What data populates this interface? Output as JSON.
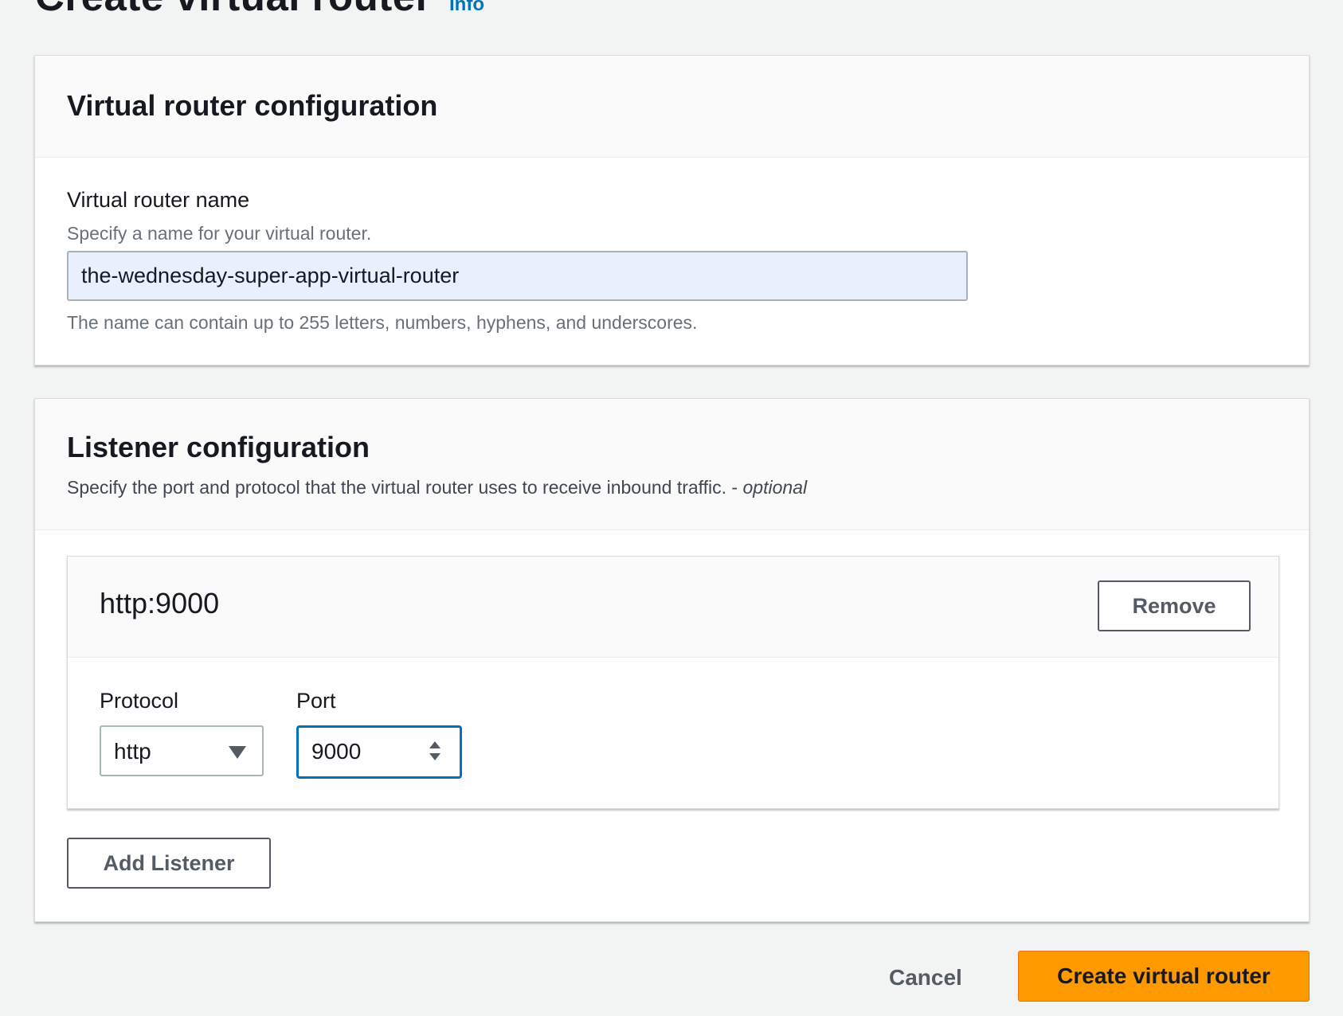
{
  "header": {
    "title": "Create virtual router",
    "info_link": "Info"
  },
  "virtual_router_config": {
    "title": "Virtual router configuration",
    "name_label": "Virtual router name",
    "name_description": "Specify a name for your virtual router.",
    "name_value": "the-wednesday-super-app-virtual-router",
    "name_constraint": "The name can contain up to 255 letters, numbers, hyphens, and underscores."
  },
  "listener_config": {
    "title": "Listener configuration",
    "description": "Specify the port and protocol that the virtual router uses to receive inbound traffic. -",
    "optional_label": "optional",
    "listener": {
      "title": "http:9000",
      "remove_label": "Remove",
      "protocol_label": "Protocol",
      "protocol_value": "http",
      "port_label": "Port",
      "port_value": "9000"
    },
    "add_listener_label": "Add Listener"
  },
  "footer": {
    "cancel_label": "Cancel",
    "create_label": "Create virtual router"
  },
  "colors": {
    "background": "#f2f3f3",
    "primary_button": "#ff9900",
    "link": "#0073bb",
    "focus_border": "#0073bb",
    "autofill_background": "#e8f0fe"
  }
}
